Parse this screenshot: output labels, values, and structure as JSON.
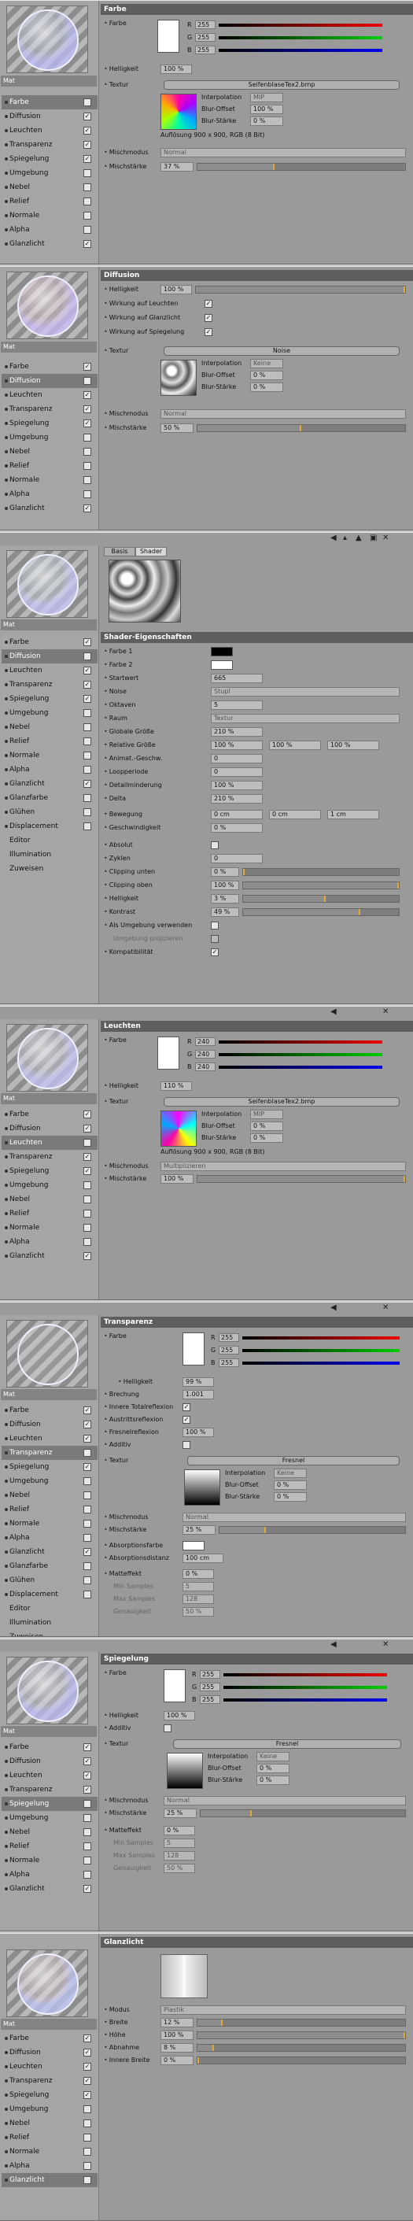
{
  "material_label": "Mat",
  "farbe": {
    "title": "Farbe",
    "channels": [
      "Farbe",
      "Diffusion",
      "Leuchten",
      "Transparenz",
      "Spiegelung",
      "Umgebung",
      "Nebel",
      "Relief",
      "Normale",
      "Alpha",
      "Glanzlicht"
    ],
    "color_label": "Farbe",
    "r": "255",
    "g": "255",
    "b": "255",
    "helligkeit_label": "Helligkeit",
    "helligkeit": "100 %",
    "textur_label": "Textur",
    "tex_name": "SeifenblaseTex2.bmp",
    "interp_label": "Interpolation",
    "interp": "MIP",
    "blur_offset_label": "Blur-Offset",
    "blur_offset": "100 %",
    "blur_staerke_label": "Blur-Stärke",
    "blur_staerke": "0 %",
    "aufloesung": "Auflösung 900 x 900, RGB (8 Bit)",
    "mischmodus_label": "Mischmodus",
    "mischmodus": "Normal",
    "mischstaerke_label": "Mischstärke",
    "mischstaerke": "37 %",
    "mischstaerke_frac": 0.37
  },
  "diffusion": {
    "title": "Diffusion",
    "helligkeit_label": "Helligkeit",
    "helligkeit": "100 %",
    "w_leuchten": "Wirkung auf Leuchten",
    "w_glanz": "Wirkung auf Glanzlicht",
    "w_spieg": "Wirkung auf Spiegelung",
    "textur_label": "Textur",
    "tex_name": "Noise",
    "interp_label": "Interpolation",
    "interp": "Keine",
    "blur_offset_label": "Blur-Offset",
    "blur_offset": "0 %",
    "blur_staerke_label": "Blur-Stärke",
    "blur_staerke": "0 %",
    "mischmodus_label": "Mischmodus",
    "mischmodus": "Normal",
    "mischstaerke_label": "Mischstärke",
    "mischstaerke": "50 %",
    "mischstaerke_frac": 0.5
  },
  "shader": {
    "tab_basis": "Basis",
    "tab_shader": "Shader",
    "title": "Shader-Eigenschaften",
    "channels": [
      "Farbe",
      "Diffusion",
      "Leuchten",
      "Transparenz",
      "Spiegelung",
      "Umgebung",
      "Nebel",
      "Relief",
      "Normale",
      "Alpha",
      "Glanzlicht",
      "Glanzfarbe",
      "Glühen",
      "Displacement",
      "Editor",
      "Illumination",
      "Zuweisen"
    ],
    "farbe1": "Farbe 1",
    "farbe2": "Farbe 2",
    "startwert_label": "Startwert",
    "startwert": "665",
    "noise_label": "Noise",
    "noise": "Stupl",
    "oktaven_label": "Oktaven",
    "oktaven": "5",
    "raum_label": "Raum",
    "raum": "Textur",
    "gg_label": "Globale Größe",
    "gg": "210 %",
    "rg_label": "Relative Größe",
    "rg1": "100 %",
    "rg2": "100 %",
    "rg3": "100 %",
    "anim_label": "Animat.-Geschw.",
    "anim": "0",
    "loop_label": "Loopperiode",
    "loop": "0",
    "detail_label": "Detailminderung",
    "detail": "100 %",
    "delta_label": "Delta",
    "delta": "210 %",
    "bew_label": "Bewegung",
    "bew1": "0 cm",
    "bew2": "0 cm",
    "bew3": "1 cm",
    "gesch_label": "Geschwindigkeit",
    "gesch": "0 %",
    "absolut_label": "Absolut",
    "zyklen_label": "Zyklen",
    "zyklen": "0",
    "cu_label": "Clipping unten",
    "cu": "0 %",
    "cu_frac": 0,
    "co_label": "Clipping oben",
    "co": "100 %",
    "co_frac": 1,
    "hell_label": "Helligkeit",
    "hell": "3 %",
    "hell_frac": 0.53,
    "kontrast_label": "Kontrast",
    "kontrast": "49 %",
    "kontrast_frac": 0.75,
    "alsumg_label": "Als Umgebung verwenden",
    "umgproj_label": "Umgebung projizieren",
    "kompat_label": "Kompatibilität"
  },
  "leuchten": {
    "title": "Leuchten",
    "color_label": "Farbe",
    "r": "240",
    "g": "240",
    "b": "240",
    "helligkeit_label": "Helligkeit",
    "helligkeit": "110 %",
    "textur_label": "Textur",
    "tex_name": "SeifenblaseTex2.bmp",
    "interp_label": "Interpolation",
    "interp": "MIP",
    "blur_offset_label": "Blur-Offset",
    "blur_offset": "0 %",
    "blur_staerke_label": "Blur-Stärke",
    "blur_staerke": "0 %",
    "aufloesung": "Auflösung 900 x 900, RGB (8 Bit)",
    "mischmodus_label": "Mischmodus",
    "mischmodus": "Multiplizieren",
    "mischstaerke_label": "Mischstärke",
    "mischstaerke": "100 %",
    "mischstaerke_frac": 1
  },
  "transparenz": {
    "title": "Transparenz",
    "color_label": "Farbe",
    "r": "255",
    "g": "255",
    "b": "255",
    "helligkeit_label": "Helligkeit",
    "helligkeit": "99 %",
    "brechung_label": "Brechung",
    "brechung": "1.001",
    "itr_label": "Innere Totalreflexion",
    "austritt_label": "Austrittsreflexion",
    "fresnel_label": "Fresnelreflexion",
    "fresnel": "100 %",
    "additiv_label": "Additiv",
    "textur_label": "Textur",
    "tex_name": "Fresnel",
    "interp_label": "Interpolation",
    "interp": "Keine",
    "blur_offset_label": "Blur-Offset",
    "blur_offset": "0 %",
    "blur_staerke_label": "Blur-Stärke",
    "blur_staerke": "0 %",
    "mischmodus_label": "Mischmodus",
    "mischmodus": "Normal",
    "mischstaerke_label": "Mischstärke",
    "mischstaerke": "25 %",
    "mischstaerke_frac": 0.25,
    "absfarbe_label": "Absorptionsfarbe",
    "absdist_label": "Absorptionsdistanz",
    "absdist": "100 cm",
    "matteffekt_label": "Matteffekt",
    "matteffekt": "0 %",
    "minsamples_label": "Min Samples",
    "minsamples": "5",
    "maxsamples_label": "Max Samples",
    "maxsamples": "128",
    "genau_label": "Genauigkeit",
    "genau": "50 %"
  },
  "spiegelung": {
    "title": "Spiegelung",
    "color_label": "Farbe",
    "r": "255",
    "g": "255",
    "b": "255",
    "helligkeit_label": "Helligkeit",
    "helligkeit": "100 %",
    "additiv_label": "Additiv",
    "textur_label": "Textur",
    "tex_name": "Fresnel",
    "interp_label": "Interpolation",
    "interp": "Keine",
    "blur_offset_label": "Blur-Offset",
    "blur_offset": "0 %",
    "blur_staerke_label": "Blur-Stärke",
    "blur_staerke": "0 %",
    "mischmodus_label": "Mischmodus",
    "mischmodus": "Normal",
    "mischstaerke_label": "Mischstärke",
    "mischstaerke": "25 %",
    "mischstaerke_frac": 0.25,
    "matteffekt_label": "Matteffekt",
    "matteffekt": "0 %",
    "minsamples_label": "Min Samples",
    "minsamples": "5",
    "maxsamples_label": "Max Samples",
    "maxsamples": "128",
    "genau_label": "Genauigkeit",
    "genau": "50 %"
  },
  "glanzlicht": {
    "title": "Glanzlicht",
    "modus_label": "Modus",
    "modus": "Plastik",
    "breite_label": "Breite",
    "breite": "12 %",
    "breite_frac": 0.12,
    "hoehe_label": "Höhe",
    "hoehe": "100 %",
    "hoehe_frac": 1,
    "abnahme_label": "Abnahme",
    "abnahme": "8 %",
    "abnahme_frac": 0.08,
    "innere_label": "Innere Breite",
    "innere": "0 %",
    "innere_frac": 0
  },
  "colors": {
    "accent": "#e0a93a",
    "title_bg": "#5e5e5e",
    "panel_bg": "#9a9a9a"
  }
}
